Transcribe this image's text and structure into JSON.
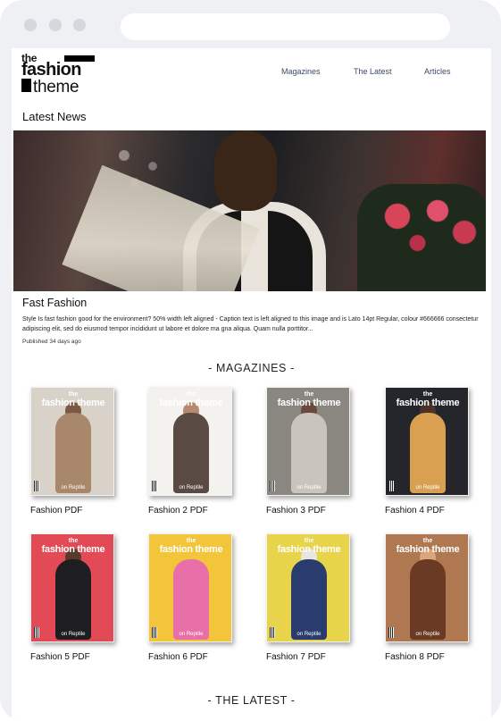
{
  "logo": {
    "line1": "the",
    "line2": "fashion",
    "line3": "theme"
  },
  "nav": [
    "Magazines",
    "The Latest",
    "Articles"
  ],
  "latest_news": {
    "heading": "Latest News"
  },
  "featured_article": {
    "title": "Fast Fashion",
    "body": "Style Is fast fashion good for the environment? 50% width left aligned - Caption text is left aligned to this image and is Lato 14pt Regular, colour #666666 consectetur adipiscing elit, sed do eiusmod tempor incididunt ut labore et dolore ma gna aliqua. Quam nulla porttitor...",
    "published": "Published 34 days ago"
  },
  "magazines_heading": "- MAGAZINES -",
  "latest_heading": "- THE LATEST -",
  "magazines": [
    {
      "label": "Fashion PDF",
      "the": "the",
      "brand": "fashion theme",
      "on": "on Reptile",
      "bg": "#d9d2c8",
      "figure": "#a9876a",
      "head": "#7a5a44"
    },
    {
      "label": "Fashion 2 PDF",
      "the": "the",
      "brand": "fashion theme",
      "on": "on Reptile",
      "bg": "#f4f2ee",
      "figure": "#5a4a44",
      "head": "#b78a70"
    },
    {
      "label": "Fashion 3 PDF",
      "the": "the",
      "brand": "fashion theme",
      "on": "on Reptile",
      "bg": "#8a8680",
      "figure": "#c9c5bd",
      "head": "#6a4a3c"
    },
    {
      "label": "Fashion 4 PDF",
      "the": "the",
      "brand": "fashion theme",
      "on": "on Reptile",
      "bg": "#24262c",
      "figure": "#d8a050",
      "head": "#4a3228"
    },
    {
      "label": "Fashion 5 PDF",
      "the": "the",
      "brand": "fashion theme",
      "on": "on Reptile",
      "bg": "#e24a55",
      "figure": "#1e1e22",
      "head": "#5a3a2c"
    },
    {
      "label": "Fashion 6 PDF",
      "the": "the",
      "brand": "fashion theme",
      "on": "on Reptile",
      "bg": "#f2c53a",
      "figure": "#e86fa8",
      "head": "#f2c53a"
    },
    {
      "label": "Fashion 7 PDF",
      "the": "the",
      "brand": "fashion theme",
      "on": "on Reptile",
      "bg": "#e8d44a",
      "figure": "#2a3c6e",
      "head": "#e9e6e0"
    },
    {
      "label": "Fashion 8 PDF",
      "the": "the",
      "brand": "fashion theme",
      "on": "on Reptile",
      "bg": "#b07850",
      "figure": "#6a3a24",
      "head": "#d9a77c"
    }
  ]
}
